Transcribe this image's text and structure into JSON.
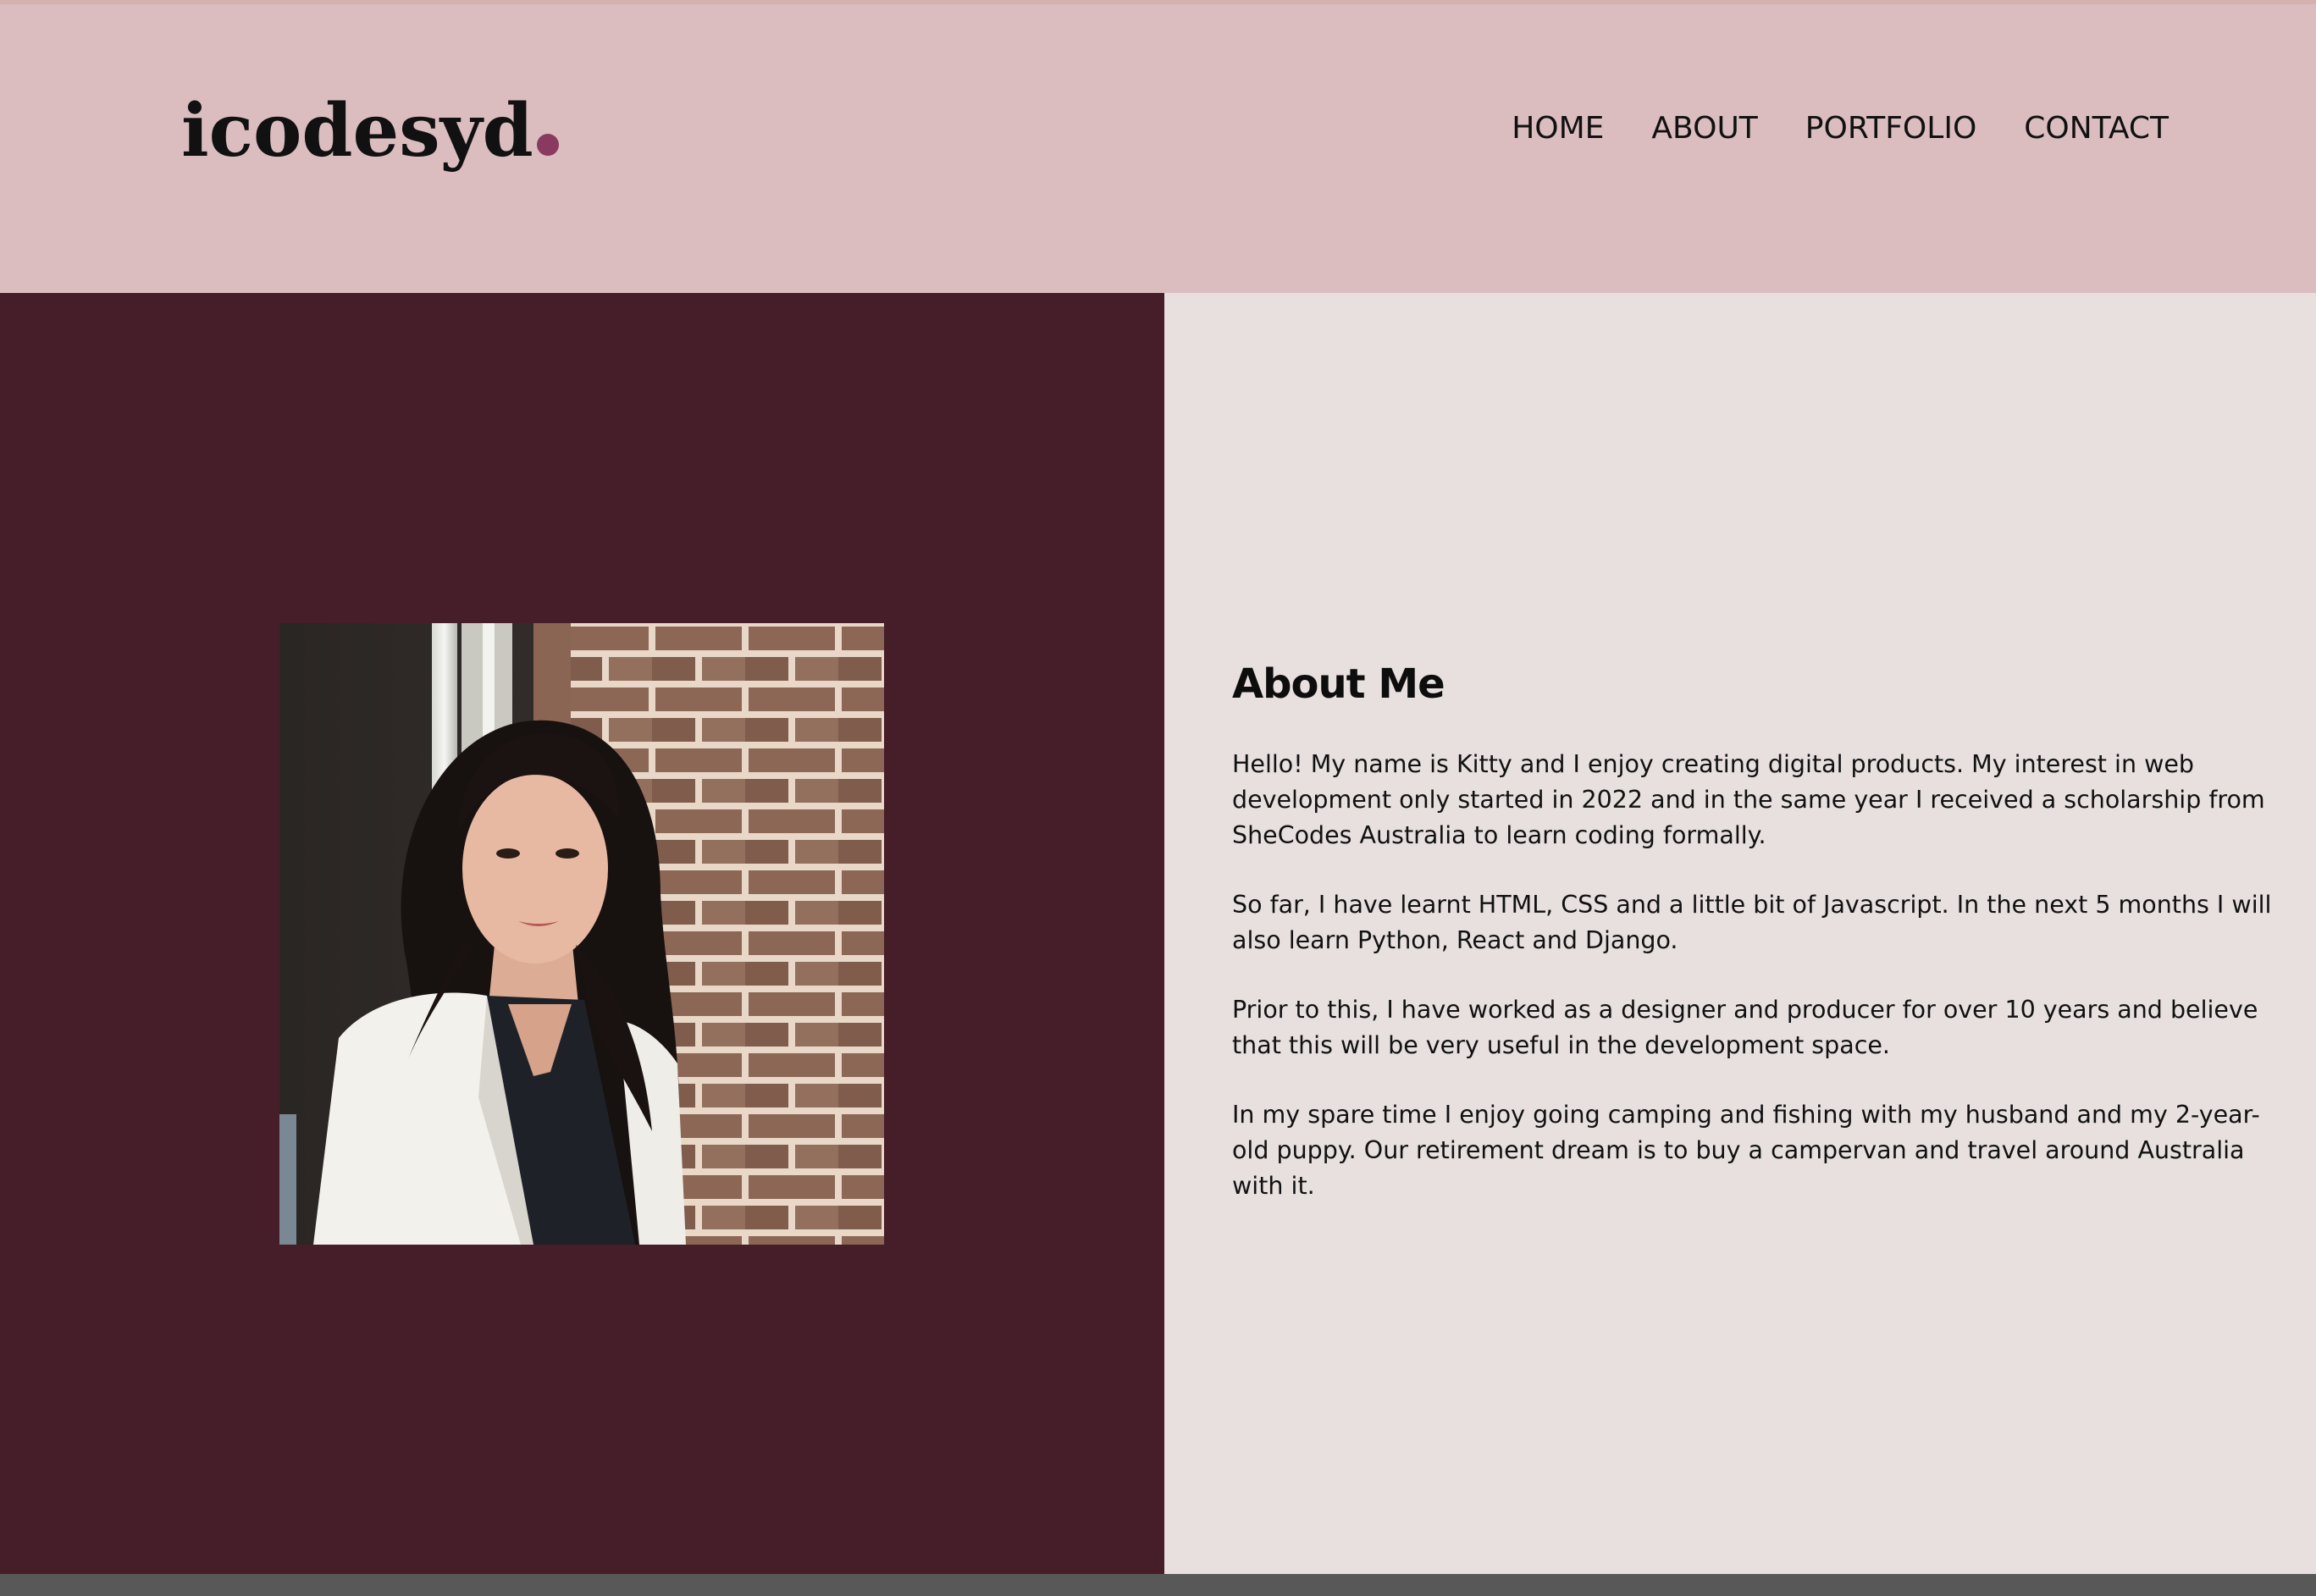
{
  "header": {
    "logo_text": "icodesyd",
    "nav": [
      {
        "label": "HOME"
      },
      {
        "label": "ABOUT"
      },
      {
        "label": "PORTFOLIO"
      },
      {
        "label": "CONTACT"
      }
    ]
  },
  "about": {
    "title": "About Me",
    "paragraphs": [
      "Hello! My name is Kitty and I enjoy creating digital products. My interest in web development only started in 2022 and in the same year I received a scholarship from SheCodes Australia to learn coding formally.",
      "So far, I have learnt HTML, CSS and a little bit of Javascript. In the next 5 months I will also learn Python, React and Django.",
      "Prior to this, I have worked as a designer and producer for over 10 years and believe that this will be very useful in the development space.",
      "In my spare time I enjoy going camping and fishing with my husband and my 2-year-old puppy. Our retirement dream is to buy a campervan and travel around Australia with it."
    ]
  },
  "colors": {
    "header_bg": "#dbbdbf",
    "left_panel_bg": "#461e2a",
    "right_panel_bg": "#e8dfdf",
    "logo_dot": "#8a3a5e",
    "footer_bar": "#585858"
  }
}
